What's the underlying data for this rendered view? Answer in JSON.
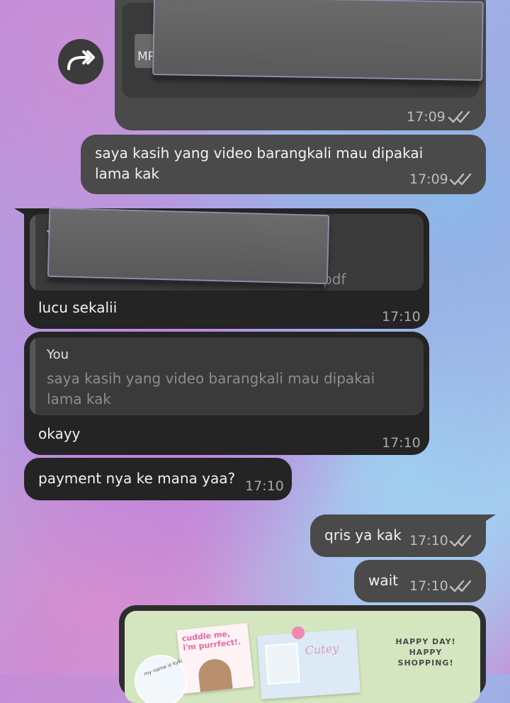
{
  "messages": [
    {
      "id": "m1",
      "direction": "out",
      "attachment_label": "MP",
      "time": "17:09",
      "status": "read"
    },
    {
      "id": "m2",
      "direction": "out",
      "text": "saya kasih yang video barangkali mau dipakai lama kak",
      "time": "17:09",
      "status": "read"
    },
    {
      "id": "m3",
      "direction": "in",
      "quote": {
        "author": "Y",
        "text": "pdf"
      },
      "text": "lucu sekalii",
      "time": "17:10"
    },
    {
      "id": "m4",
      "direction": "in",
      "quote": {
        "author": "You",
        "text": "saya kasih yang video barangkali mau dipakai lama kak"
      },
      "text": "okayy",
      "time": "17:10"
    },
    {
      "id": "m5",
      "direction": "in",
      "text": "payment nya ke mana yaa?",
      "time": "17:10"
    },
    {
      "id": "m6",
      "direction": "out",
      "text": "qris ya kak",
      "time": "17:10",
      "status": "read"
    },
    {
      "id": "m7",
      "direction": "out",
      "text": "wait",
      "time": "17:10",
      "status": "read"
    },
    {
      "id": "m8",
      "direction": "out",
      "image": {
        "text1": "cuddle me, i'm purrfect!.",
        "text2": "HAPPY DAY! HAPPY SHOPPING!",
        "text3": "my name is kyki",
        "text4": "Cutey"
      }
    }
  ],
  "icons": {
    "forward": "forward-share-icon",
    "ticks": "double-check-icon"
  },
  "colors": {
    "out_bubble": "#4a4a4a",
    "in_bubble": "#242424",
    "tick": "#bdbdbd"
  }
}
